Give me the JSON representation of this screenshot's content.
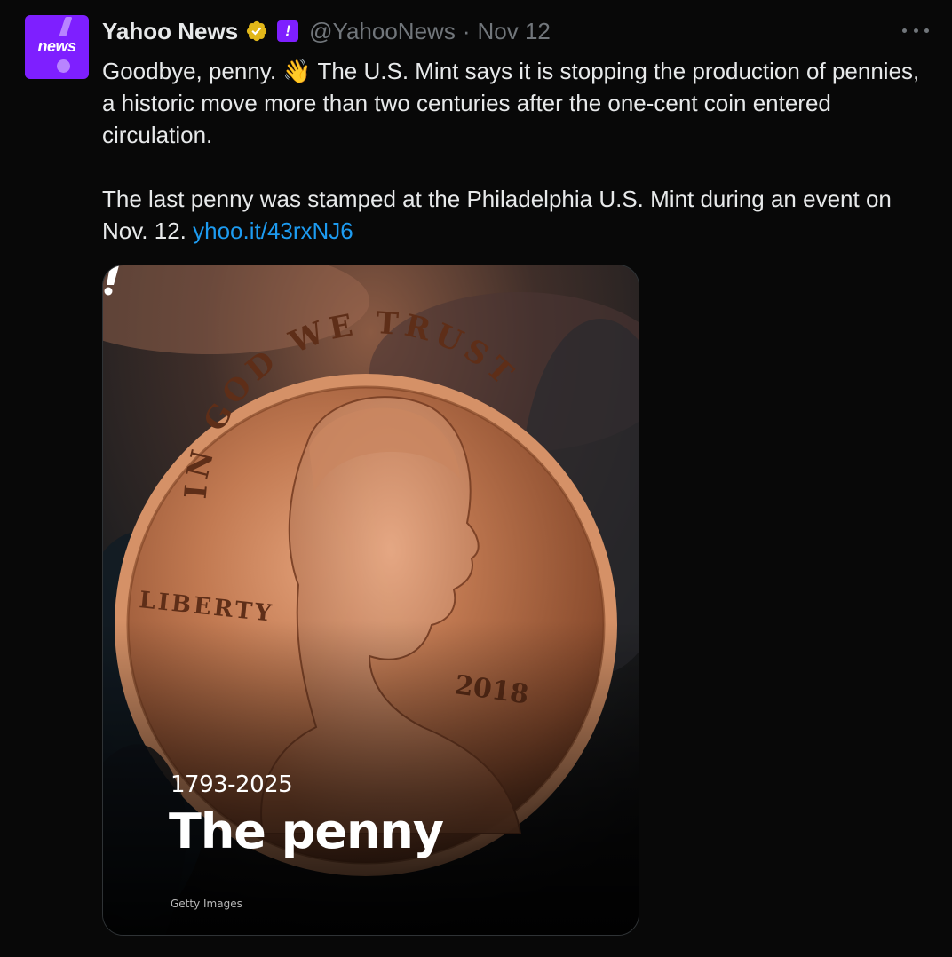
{
  "avatar": {
    "label": "news"
  },
  "header": {
    "display_name": "Yahoo News",
    "affiliation_glyph": "!",
    "handle": "@YahooNews",
    "separator": "·",
    "date": "Nov 12"
  },
  "tweet": {
    "paragraph1_before": "Goodbye, penny. ",
    "wave_emoji": "👋",
    "paragraph1_after": " The U.S. Mint says it is stopping the production of pennies, a historic move more than two centuries after the one-cent coin entered circulation.",
    "paragraph2": "The last penny was stamped at the Philadelphia U.S. Mint during an event on Nov. 12. ",
    "link": "yhoo.it/43rxNJ6"
  },
  "media": {
    "coin_top_inscription": "IN GOD WE TRUST",
    "coin_left_inscription": "LIBERTY",
    "coin_year": "2018",
    "years": "1793-2025",
    "title": "The penny",
    "credit": "Getty Images"
  },
  "icons": {
    "verified": "verified-badge-icon",
    "more": "more-options-icon",
    "brand": "yahoo-exclamation-icon"
  },
  "colors": {
    "background": "#080808",
    "brand_purple": "#7e1fff",
    "link_blue": "#1d9bf0",
    "muted_text": "#71767b",
    "verified_gold": "#e2b719",
    "copper": "#b5673f"
  }
}
